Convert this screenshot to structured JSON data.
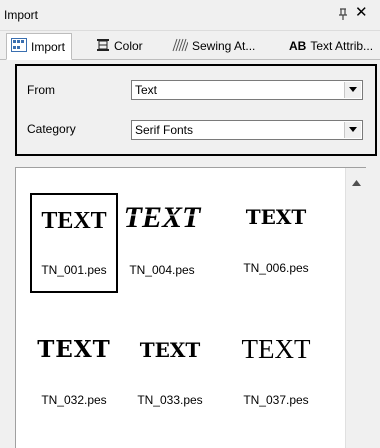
{
  "panel": {
    "title": "Import"
  },
  "tabs": [
    {
      "label": "Import",
      "icon": "import-icon",
      "active": true
    },
    {
      "label": "Color",
      "icon": "color-icon"
    },
    {
      "label": "Sewing At...",
      "icon": "sewing-icon"
    },
    {
      "label": "Text Attrib...",
      "icon": "text-attrib-icon",
      "icon_text": "AB"
    }
  ],
  "form": {
    "from_label": "From",
    "from_value": "Text",
    "category_label": "Category",
    "category_value": "Serif Fonts"
  },
  "items": [
    {
      "preview": "TEXT",
      "name": "TN_001.pes",
      "selected": true
    },
    {
      "preview": "TEXT",
      "name": "TN_004.pes"
    },
    {
      "preview": "TEXT",
      "name": "TN_006.pes"
    },
    {
      "preview": "TEXT",
      "name": "TN_032.pes"
    },
    {
      "preview": "TEXT",
      "name": "TN_033.pes"
    },
    {
      "preview": "TEXT",
      "name": "TN_037.pes"
    }
  ]
}
